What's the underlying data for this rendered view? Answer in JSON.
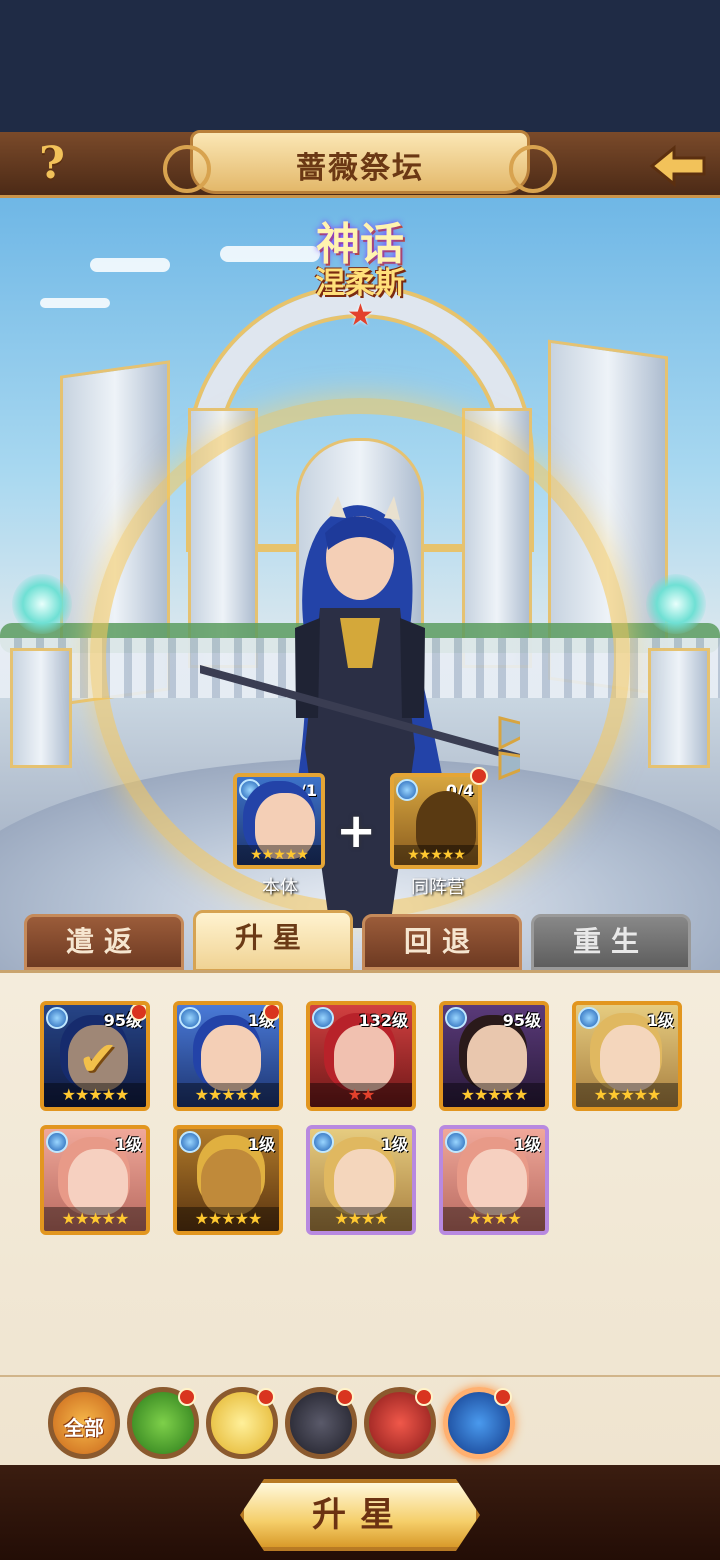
{
  "header": {
    "title": "蔷薇祭坛",
    "help_icon": "?"
  },
  "hero": {
    "rarity": "神话",
    "name": "涅柔斯",
    "star_glyph": "★"
  },
  "fusion": {
    "main": {
      "label": "本体",
      "count": "1/1",
      "stars": "★★★★★"
    },
    "plus": "+",
    "same_faction": {
      "label": "同阵营",
      "count": "0/4",
      "stars": "★★★★★"
    }
  },
  "tabs": [
    {
      "label": "遣返"
    },
    {
      "label": "升星"
    },
    {
      "label": "回退"
    },
    {
      "label": "重生"
    }
  ],
  "active_tab": "升星",
  "heroes": [
    {
      "level": "95级",
      "stars": "★★★★★",
      "selected": true,
      "new": true
    },
    {
      "level": "1级",
      "stars": "★★★★★",
      "new": true
    },
    {
      "level": "132级",
      "stars": "★★"
    },
    {
      "level": "95级",
      "stars": "★★★★★"
    },
    {
      "level": "1级",
      "stars": "★★★★★"
    },
    {
      "level": "1级",
      "stars": "★★★★★"
    },
    {
      "level": "1级",
      "stars": "★★★★★"
    },
    {
      "level": "1级",
      "stars": "★★★★"
    },
    {
      "level": "1级",
      "stars": "★★★★"
    }
  ],
  "filters": [
    {
      "label": "全部",
      "icon": "all-icon"
    },
    {
      "label": "",
      "icon": "dragon-faction-icon",
      "new": true
    },
    {
      "label": "",
      "icon": "rose-faction-icon",
      "new": true
    },
    {
      "label": "",
      "icon": "rune-faction-icon",
      "new": true
    },
    {
      "label": "",
      "icon": "phoenix-faction-icon",
      "new": true
    },
    {
      "label": "",
      "icon": "water-faction-icon",
      "new": true,
      "selected": true
    }
  ],
  "action": {
    "upgrade_label": "升星"
  },
  "colors": {
    "accent_gold": "#e2961f",
    "header_brown": "#6b3a1c",
    "panel_bg": "#f4ecdc",
    "badge_red": "#d9341f"
  }
}
